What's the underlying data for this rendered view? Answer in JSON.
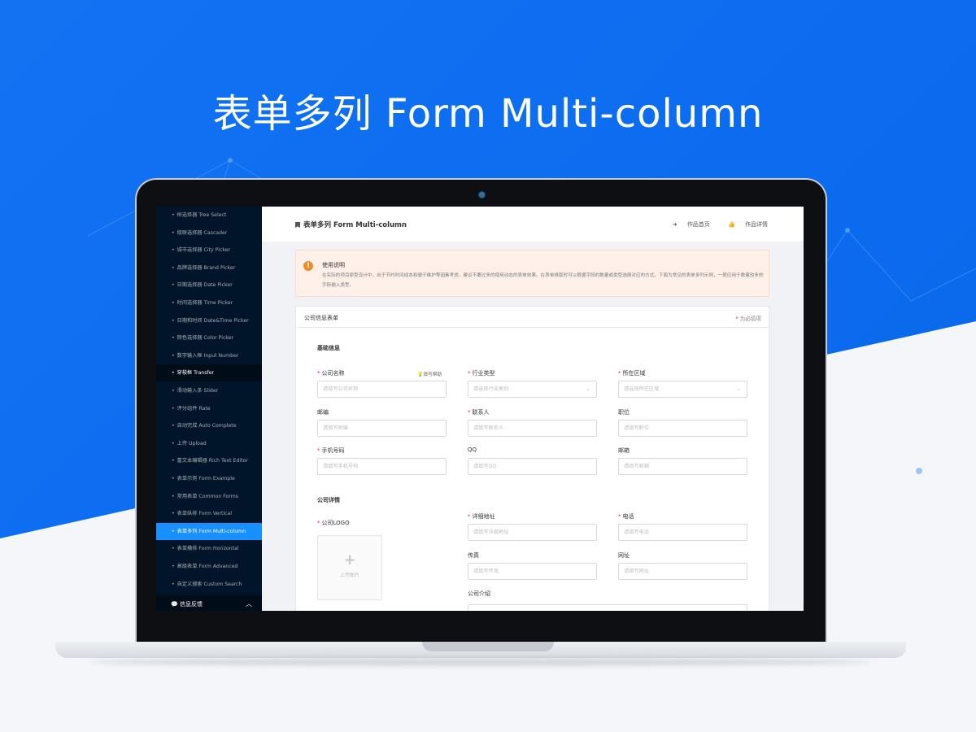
{
  "banner": {
    "title": "表单多列 Form Multi-column"
  },
  "sidebar": {
    "items": [
      {
        "label": "树选择器 Tree Select"
      },
      {
        "label": "级联选择器 Cascader"
      },
      {
        "label": "城市选择器 City Picker"
      },
      {
        "label": "品牌选择器 Brand Picker"
      },
      {
        "label": "日期选择器 Date Picker"
      },
      {
        "label": "时间选择器 Time Picker"
      },
      {
        "label": "日期和时间 Date&Time Picker"
      },
      {
        "label": "颜色选择器 Color Picker"
      },
      {
        "label": "数字输入框 Input Number"
      },
      {
        "label": "穿梭框 Transfer"
      },
      {
        "label": "滑动输入条 Slider"
      },
      {
        "label": "评分组件 Rate"
      },
      {
        "label": "自动完成 Auto Complete"
      },
      {
        "label": "上传 Upload"
      },
      {
        "label": "富文本编辑器 Rich Text Editor"
      },
      {
        "label": "表单示例 Form Example"
      },
      {
        "label": "常用表单 Common Forms"
      },
      {
        "label": "表单纵排 Form Vertical"
      },
      {
        "label": "表单多列 Form Multi-column"
      },
      {
        "label": "表单横排 Form Horizontal"
      },
      {
        "label": "高级表单 Form Advanced"
      },
      {
        "label": "自定义搜索 Custom Search"
      }
    ],
    "group_label": "信息反馈"
  },
  "header": {
    "title": "表单多列 Form Multi-column",
    "link_home": "作品首页",
    "link_detail": "作品详情"
  },
  "notice": {
    "title": "使用说明",
    "text": "在实际的项目原型设计中，出于节约时间成本和便于维护等因素考虑，建议不要过多的使用动态的表单效果。在表单排版时可以根据字段的数量或类型选择对应的方式，下面为常见的表单多列示例，一般应用于数量较多的字段输入类型。"
  },
  "form": {
    "card_title": "公司信息表单",
    "required_note": "为必填项",
    "section_basic": "基础信息",
    "section_detail": "公司详情",
    "fields": {
      "company_name": {
        "label": "公司名称",
        "placeholder": "请填写公司名称",
        "help": "填写帮助"
      },
      "industry": {
        "label": "行业类型",
        "placeholder": "请选择行业类别"
      },
      "region": {
        "label": "所在区域",
        "placeholder": "请选择所在区域"
      },
      "postcode": {
        "label": "邮编",
        "placeholder": "请填写邮编"
      },
      "contact": {
        "label": "联系人",
        "placeholder": "请填写联系人"
      },
      "position": {
        "label": "职位",
        "placeholder": "请填写职位"
      },
      "mobile": {
        "label": "手机号码",
        "placeholder": "请填写手机号码"
      },
      "qq": {
        "label": "QQ",
        "placeholder": "请填写QQ"
      },
      "email": {
        "label": "邮箱",
        "placeholder": "请填写邮箱"
      },
      "logo": {
        "label": "公司LOGO",
        "upload_text": "上传图片"
      },
      "address": {
        "label": "详细地址",
        "placeholder": "请填写详细地址"
      },
      "phone": {
        "label": "电话",
        "placeholder": "请填写电话"
      },
      "fax": {
        "label": "传真",
        "placeholder": "请填写传真"
      },
      "website": {
        "label": "网址",
        "placeholder": "请填写网址"
      },
      "intro": {
        "label": "公司介绍"
      }
    }
  },
  "colors": {
    "brand": "#0b6cf0",
    "sidebar_bg": "#001529",
    "active_item": "#1890ff",
    "required": "#f5222d",
    "notice_icon": "#f08a24"
  }
}
